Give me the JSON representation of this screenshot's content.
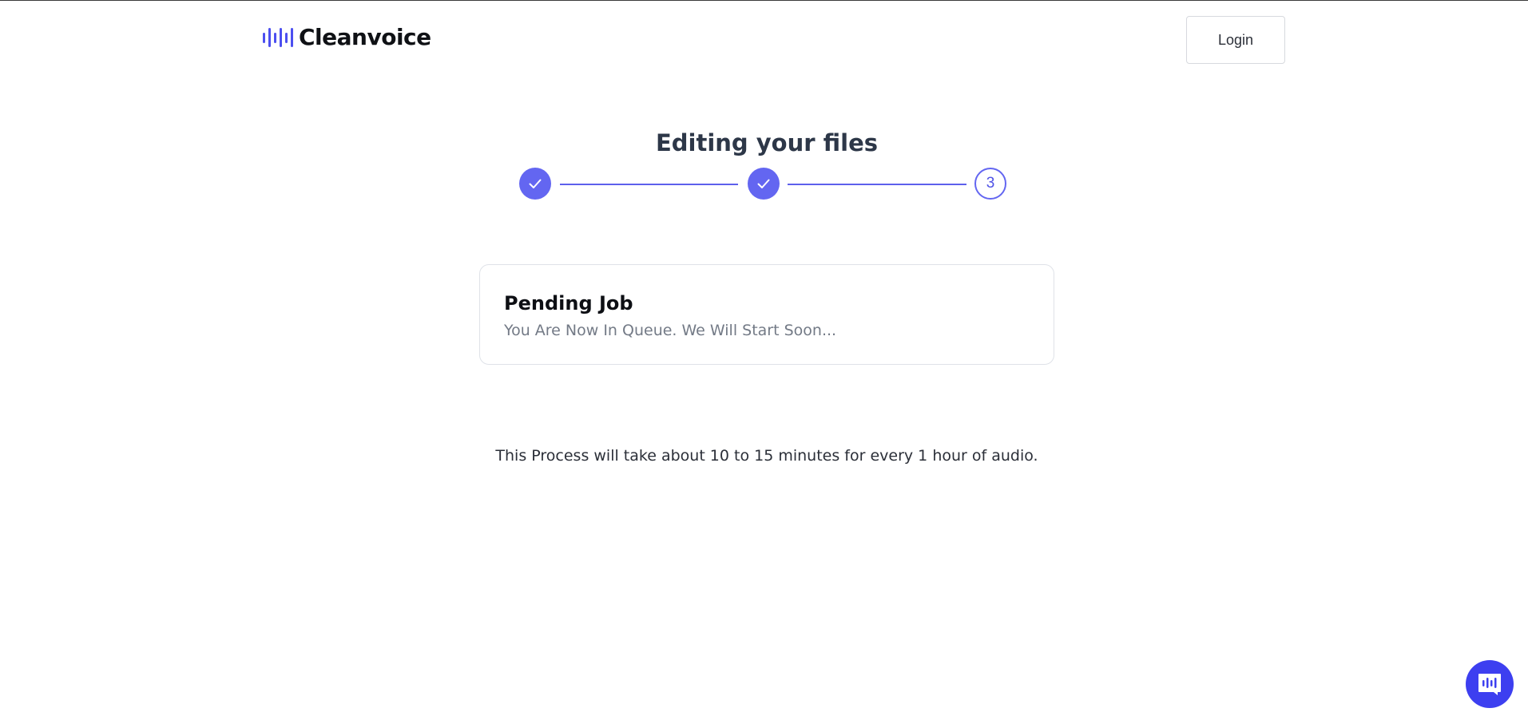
{
  "header": {
    "brand_name": "Cleanvoice",
    "login_label": "Login"
  },
  "main": {
    "title": "Editing your files",
    "steps": [
      {
        "state": "done",
        "label": ""
      },
      {
        "state": "done",
        "label": ""
      },
      {
        "state": "current",
        "label": "3"
      }
    ],
    "card": {
      "title": "Pending Job",
      "subtitle": "You Are Now In Queue. We Will Start Soon..."
    },
    "process_note": "This Process will take about 10 to 15 minutes for every 1 hour of audio."
  },
  "chat_widget": {
    "icon": "chat-waveform-icon"
  },
  "colors": {
    "accent": "#6366f1",
    "brand_blue": "#3d3ff0",
    "title_text": "#2d3748",
    "muted_text": "#737a86"
  },
  "icons": {
    "logo": "waveform-logo-icon",
    "step_done": "checkmark-icon"
  }
}
